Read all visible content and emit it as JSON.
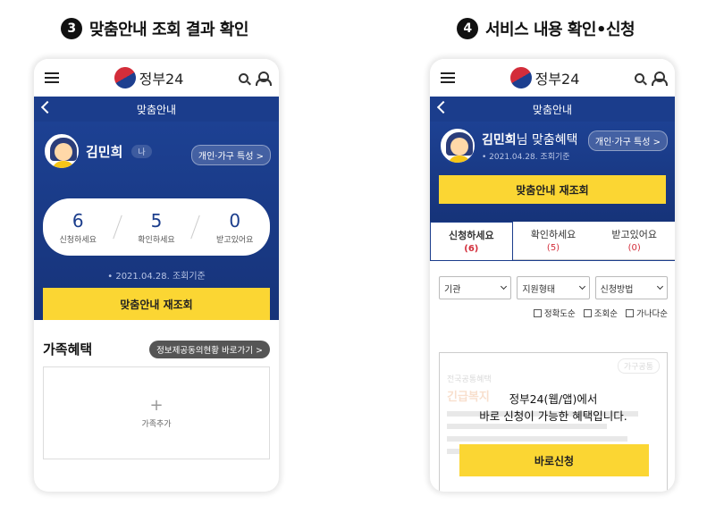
{
  "step3": {
    "number": "3",
    "title": "맞춤안내 조회 결과 확인"
  },
  "step4": {
    "number": "4",
    "title": "서비스 내용 확인•신청"
  },
  "app": {
    "logo_text": "정부24",
    "page_title": "맞춤안내"
  },
  "left": {
    "name": "김민희",
    "me_tag": "나",
    "profile_link": "개인·가구 특성 >",
    "stats": [
      {
        "value": "6",
        "label": "신청하세요"
      },
      {
        "value": "5",
        "label": "확인하세요"
      },
      {
        "value": "0",
        "label": "받고있어요"
      }
    ],
    "date": "• 2021.04.28. 조회기준",
    "recheck_button": "맞춤안내 재조회",
    "family_title": "가족혜택",
    "family_link": "정보제공동의현황 바로가기 >",
    "family_add_icon": "+",
    "family_add_label": "가족추가"
  },
  "right": {
    "name": "김민희",
    "name_suffix": "님 맞춤혜택",
    "date": "• 2021.04.28. 조회기준",
    "profile_link": "개인·가구 특성 >",
    "recheck_button": "맞춤안내 재조회",
    "tabs": [
      {
        "label": "신청하세요",
        "count": "(6)"
      },
      {
        "label": "확인하세요",
        "count": "(5)"
      },
      {
        "label": "받고있어요",
        "count": "(0)"
      }
    ],
    "filters": [
      "기관",
      "지원형태",
      "신청방법"
    ],
    "sorts": [
      "정확도순",
      "조회순",
      "가나다순"
    ],
    "card": {
      "faded_tag": "가구공통",
      "faded_category": "전국공통혜택",
      "faded_title": "긴급복지",
      "message_line1": "정부24(웹/앱)에서",
      "message_line2": "바로 신청이 가능한 혜택입니다.",
      "apply_button": "바로신청"
    }
  },
  "colors": {
    "navy": "#1b3d8c",
    "yellow": "#fbd633",
    "red": "#d32d3a"
  }
}
